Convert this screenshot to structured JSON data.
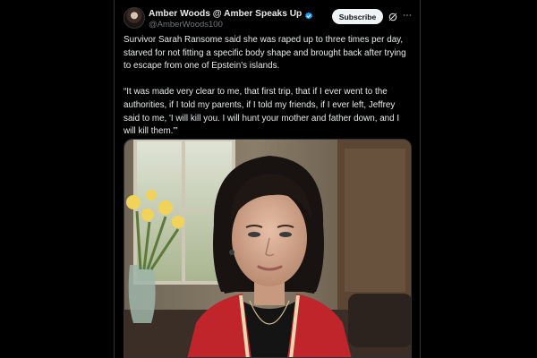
{
  "post": {
    "display_name": "Amber Woods @ Amber Speaks Up",
    "handle": "@AmberWoods100",
    "subscribe_label": "Subscribe",
    "text": "Survivor Sarah Ransome said she was raped up to three times per day, starved for not fitting a specific body shape and brought back after trying to escape from one of Epstein's islands.\n\n“It was made very clear to me, that first trip, that if I ever went to the authorities, if I told my parents, if I told my friends, if I ever left, Jeffrey said to me, 'I will kill you. I will hunt your mother and father down, and I will kill them.'”",
    "icons": {
      "verified": "verified-badge-icon",
      "grok": "grok-icon",
      "more": "more-icon"
    }
  },
  "colors": {
    "background": "#000000",
    "text": "#e7e9ea",
    "muted": "#71767b",
    "verified": "#1d9bf0",
    "subscribe_bg": "#eff3f4"
  }
}
